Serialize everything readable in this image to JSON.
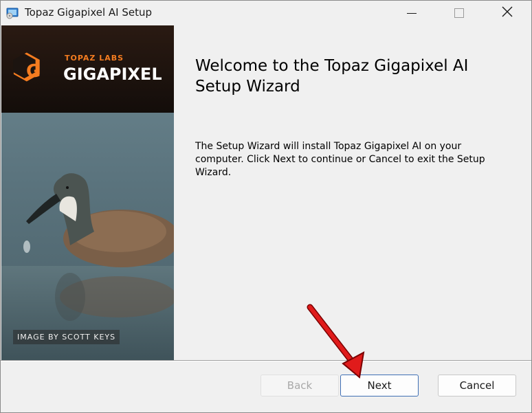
{
  "window": {
    "title": "Topaz Gigapixel AI Setup"
  },
  "banner": {
    "brand_small": "TOPAZ LABS",
    "brand_large": "GIGAPIXEL",
    "logo_letter": "G",
    "photo_credit": "IMAGE BY SCOTT KEYS"
  },
  "content": {
    "heading": "Welcome to the Topaz Gigapixel AI Setup Wizard",
    "body": "The Setup Wizard will install Topaz Gigapixel AI on your computer. Click Next to continue or Cancel to exit the Setup Wizard."
  },
  "buttons": {
    "back": "Back",
    "next": "Next",
    "cancel": "Cancel"
  },
  "colors": {
    "accent_orange": "#f47c20",
    "next_border": "#3f6fb4",
    "annotation_arrow": "#e01b1b"
  },
  "icons": [
    "installer-app-icon",
    "minimize-icon",
    "maximize-icon",
    "close-icon",
    "annotation-arrow-icon"
  ]
}
